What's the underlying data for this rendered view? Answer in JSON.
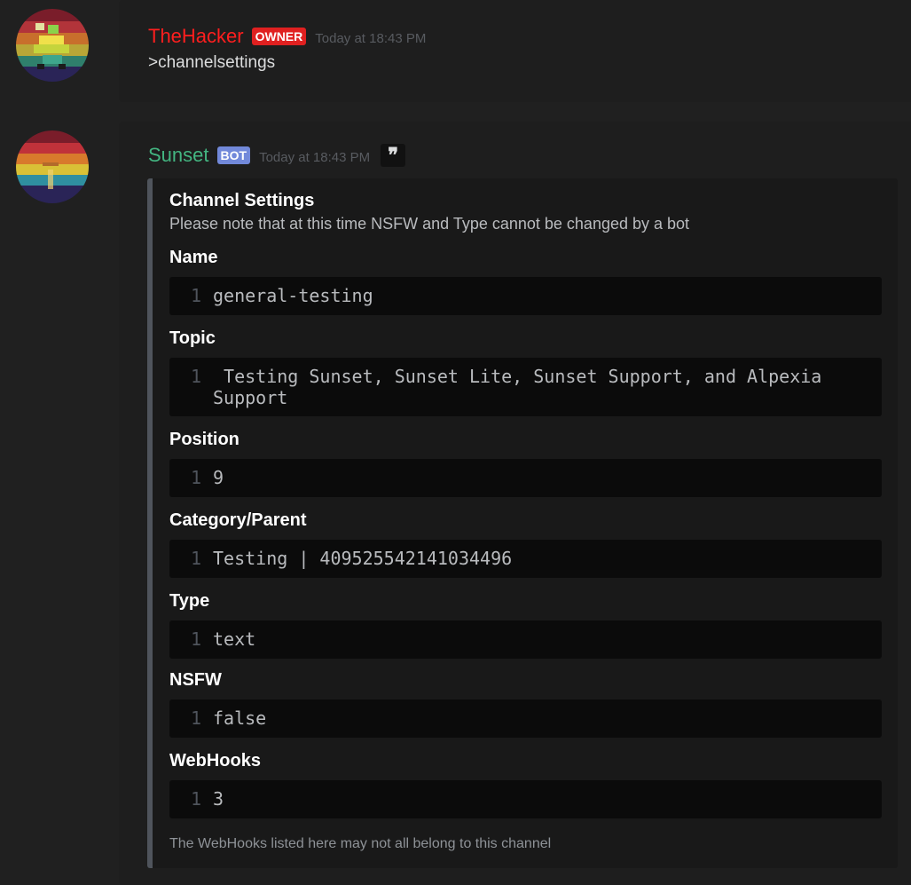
{
  "messages": [
    {
      "author": "TheHacker",
      "tag": "OWNER",
      "timestamp": "Today at 18:43 PM",
      "content": ">channelsettings"
    },
    {
      "author": "Sunset",
      "tag": "BOT",
      "timestamp": "Today at 18:43 PM",
      "quote_icon": "❞"
    }
  ],
  "embed": {
    "title": "Channel Settings",
    "description": "Please note that at this time NSFW and Type cannot be changed by a bot",
    "fields": [
      {
        "name": "Name",
        "line": "1",
        "value": "general-testing"
      },
      {
        "name": "Topic",
        "line": "1",
        "value": " Testing Sunset, Sunset Lite, Sunset Support, and Alpexia Support"
      },
      {
        "name": "Position",
        "line": "1",
        "value": "9"
      },
      {
        "name": "Category/Parent",
        "line": "1",
        "value": "Testing | 409525542141034496"
      },
      {
        "name": "Type",
        "line": "1",
        "value": "text"
      },
      {
        "name": "NSFW",
        "line": "1",
        "value": "false"
      },
      {
        "name": "WebHooks",
        "line": "1",
        "value": "3"
      }
    ],
    "footer": "The WebHooks listed here may not all belong to this channel"
  },
  "colors": {
    "owner_name": "#ff1e1e",
    "bot_name": "#43b581",
    "owner_tag": "#e02020",
    "bot_tag": "#7289da",
    "embed_border": "#4f545c"
  }
}
